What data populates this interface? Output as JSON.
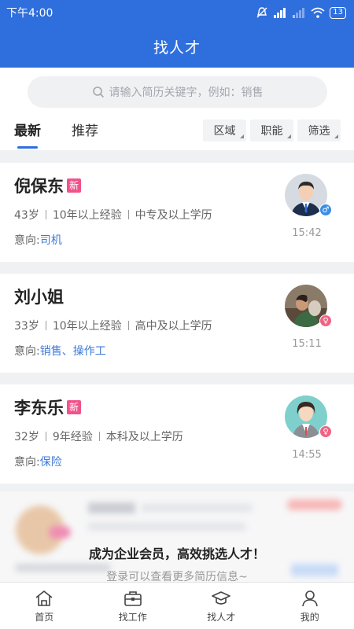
{
  "status": {
    "time": "下午4:00",
    "battery": "13"
  },
  "appbar": {
    "title": "找人才"
  },
  "search": {
    "placeholder": "请输入简历关键字，例如：销售"
  },
  "tabs": [
    {
      "label": "最新",
      "active": true
    },
    {
      "label": "推荐",
      "active": false
    }
  ],
  "filters": [
    {
      "label": "区域"
    },
    {
      "label": "职能"
    },
    {
      "label": "筛选"
    }
  ],
  "candidates": [
    {
      "name": "倪保东",
      "badge": "新",
      "age": "43岁",
      "experience": "10年以上经验",
      "education": "中专及以上学历",
      "intent_label": "意向:",
      "intent": "司机",
      "time": "15:42",
      "gender": "male",
      "gender_icon": "male-icon"
    },
    {
      "name": "刘小姐",
      "badge": "",
      "age": "33岁",
      "experience": "10年以上经验",
      "education": "高中及以上学历",
      "intent_label": "意向:",
      "intent": "销售、操作工",
      "time": "15:11",
      "gender": "female",
      "gender_icon": "female-icon"
    },
    {
      "name": "李东乐",
      "badge": "新",
      "age": "32岁",
      "experience": "9年经验",
      "education": "本科及以上学历",
      "intent_label": "意向:",
      "intent": "保险",
      "time": "14:55",
      "gender": "female",
      "gender_icon": "female-icon"
    }
  ],
  "promo": {
    "title": "成为企业会员，高效挑选人才！",
    "subtitle": "登录可以查看更多简历信息~"
  },
  "bottom_nav": [
    {
      "label": "首页",
      "icon": "home-icon",
      "active": false
    },
    {
      "label": "找工作",
      "icon": "briefcase-icon",
      "active": false
    },
    {
      "label": "找人才",
      "icon": "graduation-cap-icon",
      "active": true
    },
    {
      "label": "我的",
      "icon": "user-icon",
      "active": false
    }
  ],
  "colors": {
    "primary": "#2f6fdd",
    "new_badge": "#f2528a",
    "male": "#3a8fe6",
    "female": "#f06384",
    "link": "#3d7ad8"
  }
}
